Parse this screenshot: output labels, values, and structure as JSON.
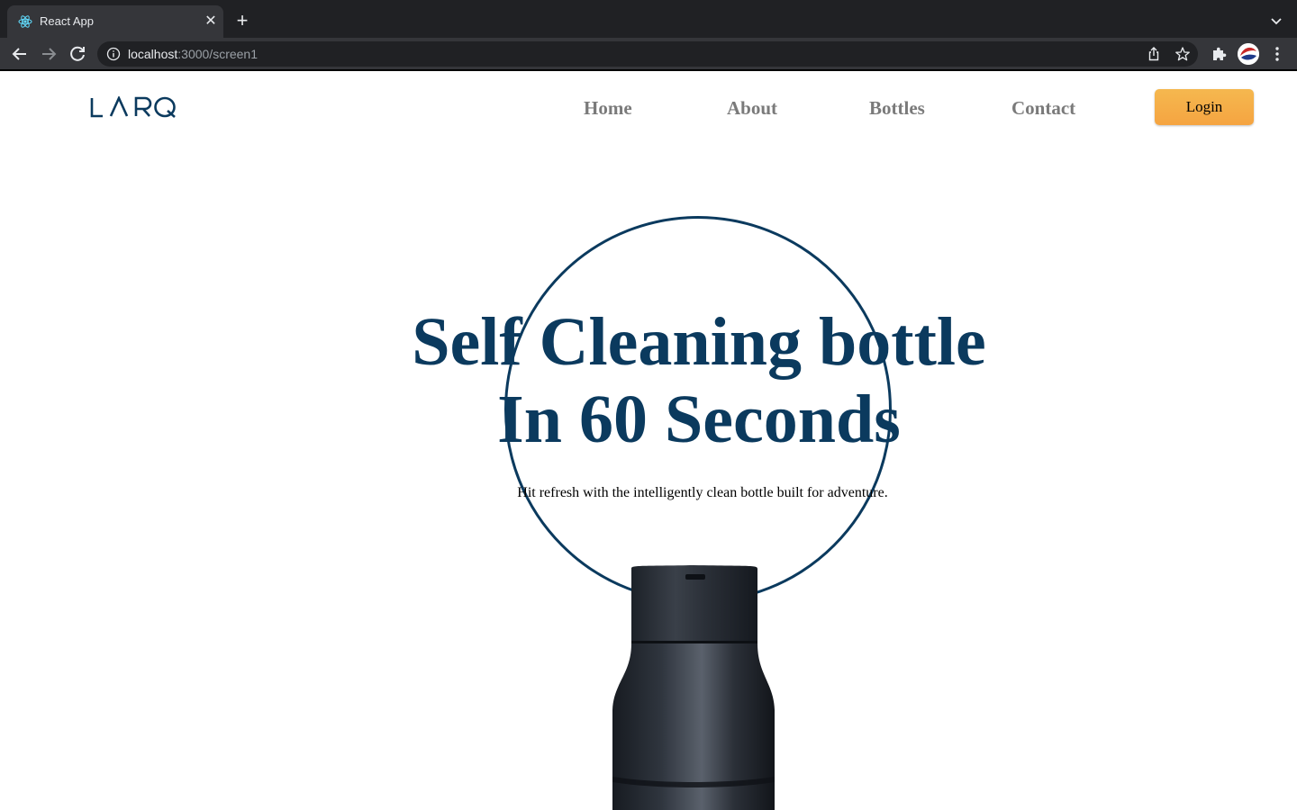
{
  "browser": {
    "tab": {
      "title": "React App",
      "favicon": "react-icon"
    },
    "url": {
      "host": "localhost",
      "path": ":3000/screen1"
    }
  },
  "site": {
    "logo": "LARQ",
    "nav": [
      {
        "label": "Home"
      },
      {
        "label": "About"
      },
      {
        "label": "Bottles"
      },
      {
        "label": "Contact"
      }
    ],
    "login_label": "Login",
    "hero": {
      "title_line1": "Self Cleaning bottle",
      "title_line2": "In 60 Seconds",
      "subtitle": "Hit refresh with the intelligently clean bottle built for adventure."
    }
  },
  "colors": {
    "brand_navy": "#0b3a5e",
    "login_orange": "#f5a441",
    "nav_gray": "#7a7a7a",
    "chrome_dark": "#202124"
  }
}
